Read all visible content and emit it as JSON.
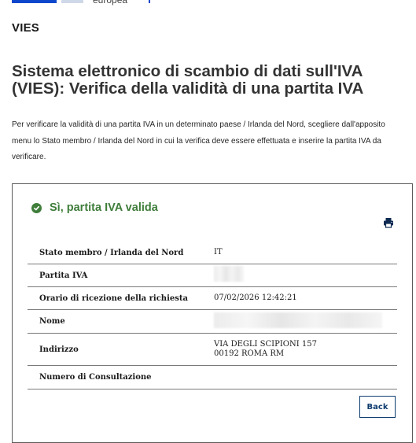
{
  "header": {
    "logo_text": "europea",
    "app_name": "VIES"
  },
  "page_title": "Sistema elettronico di scambio di dati sull'IVA (VIES): Verifica della validità di una partita IVA",
  "intro_text": "Per verificare la validità di una partita IVA in un determinato paese / Irlanda del Nord, scegliere dall'apposito menu lo Stato membro / Irlanda del Nord in cui la verifica deve essere effettuata e inserire la partita IVA da verificare.",
  "result": {
    "status_text": "Sì, partita IVA valida",
    "status_color": "#3f7d3a",
    "icon": "check-circle-icon",
    "print_icon": "print-icon"
  },
  "details": {
    "rows": [
      {
        "label": "Stato membro / Irlanda del Nord",
        "value": "IT"
      },
      {
        "label": "Partita IVA",
        "value": ""
      },
      {
        "label": "Orario di ricezione della richiesta",
        "value": "07/02/2026 12:42:21"
      },
      {
        "label": "Nome",
        "value": ""
      },
      {
        "label": "Indirizzo",
        "value_line1": "VIA DEGLI SCIPIONI 157",
        "value_line2": "00192 ROMA RM"
      },
      {
        "label": "Numero di Consultazione",
        "value": ""
      }
    ]
  },
  "actions": {
    "back_label": "Back"
  },
  "colors": {
    "brand_blue": "#0e47cb",
    "button_border": "#0e3c6e"
  }
}
